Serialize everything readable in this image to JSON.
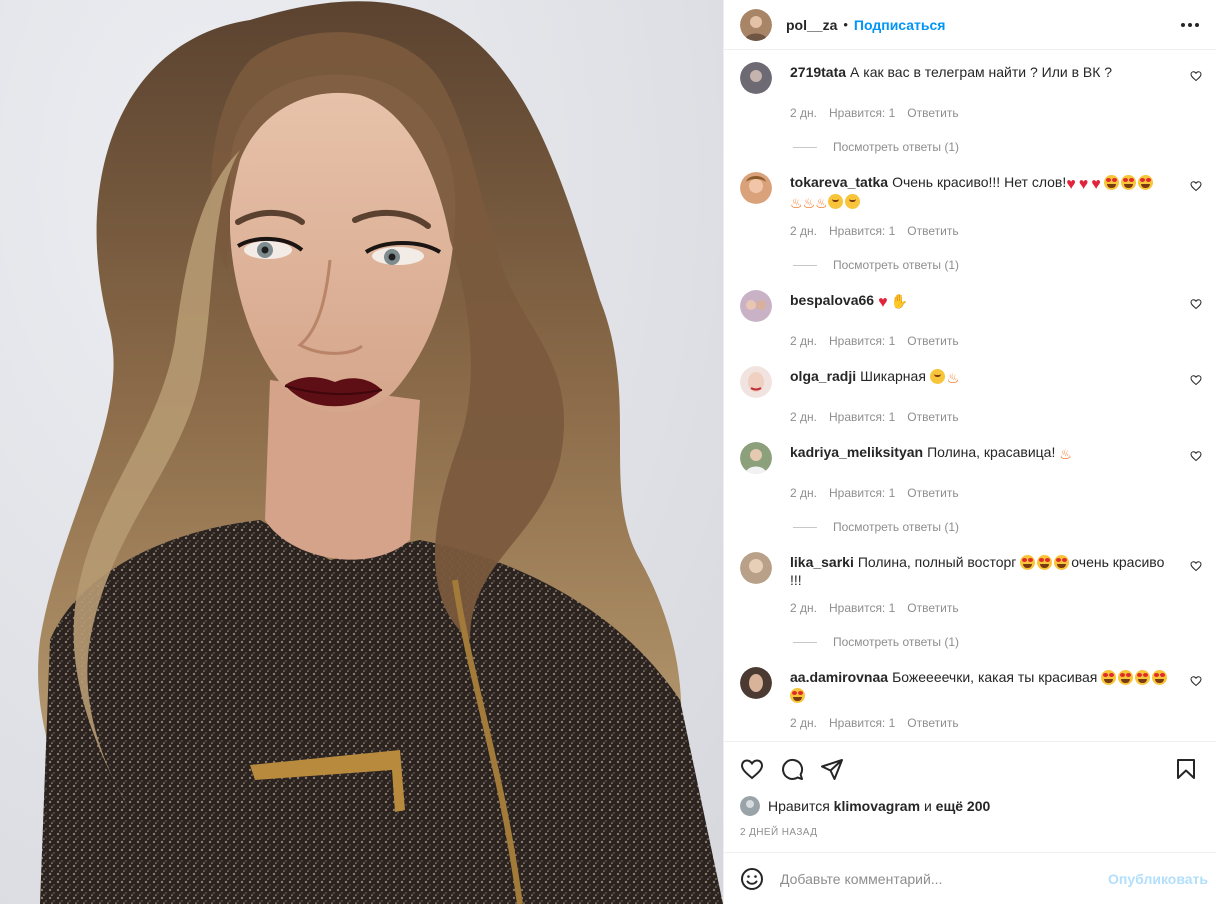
{
  "post": {
    "username": "pol__za",
    "separator": "•",
    "follow_label": "Подписаться"
  },
  "comments": [
    {
      "username": "2719tata",
      "text": "А как вас в телеграм найти ? Или в ВК ?",
      "time": "2 дн.",
      "likes": "Нравится: 1",
      "reply": "Ответить",
      "view_replies": "Посмотреть ответы (1)"
    },
    {
      "username": "tokareva_tatka",
      "text": "Очень красиво!!! Нет слов!",
      "time": "2 дн.",
      "likes": "Нравится: 1",
      "reply": "Ответить",
      "view_replies": "Посмотреть ответы (1)"
    },
    {
      "username": "bespalova66",
      "text": "",
      "time": "2 дн.",
      "likes": "Нравится: 1",
      "reply": "Ответить"
    },
    {
      "username": "olga_radji",
      "text": "Шикарная",
      "time": "2 дн.",
      "likes": "Нравится: 1",
      "reply": "Ответить"
    },
    {
      "username": "kadriya_meliksityan",
      "text": "Полина, красавица!",
      "time": "2 дн.",
      "likes": "Нравится: 1",
      "reply": "Ответить",
      "view_replies": "Посмотреть ответы (1)"
    },
    {
      "username": "lika_sarki",
      "text": "Полина, полный восторг",
      "text_after": "очень красиво !!!",
      "time": "2 дн.",
      "likes": "Нравится: 1",
      "reply": "Ответить",
      "view_replies": "Посмотреть ответы (1)"
    },
    {
      "username": "aa.damirovnaa",
      "text": "Божеееечки, какая ты красивая",
      "time": "2 дн.",
      "likes": "Нравится: 1",
      "reply": "Ответить"
    }
  ],
  "likes_line": {
    "prefix": "Нравится",
    "user": "klimovagram",
    "middle": "и",
    "more": "ещё 200"
  },
  "date": "2 дней назад",
  "add_comment": {
    "placeholder": "Добавьте комментарий...",
    "publish": "Опубликовать"
  },
  "icons": {
    "more": "more-horizontal-icon",
    "like": "heart-icon",
    "comment": "comment-icon",
    "share": "send-icon",
    "save": "bookmark-icon",
    "emoji": "smile-icon"
  },
  "colors": {
    "accent": "#0095f6",
    "publish_disabled": "#b2dffc",
    "secondary_text": "#8e8e8e",
    "divider": "#efefef"
  }
}
